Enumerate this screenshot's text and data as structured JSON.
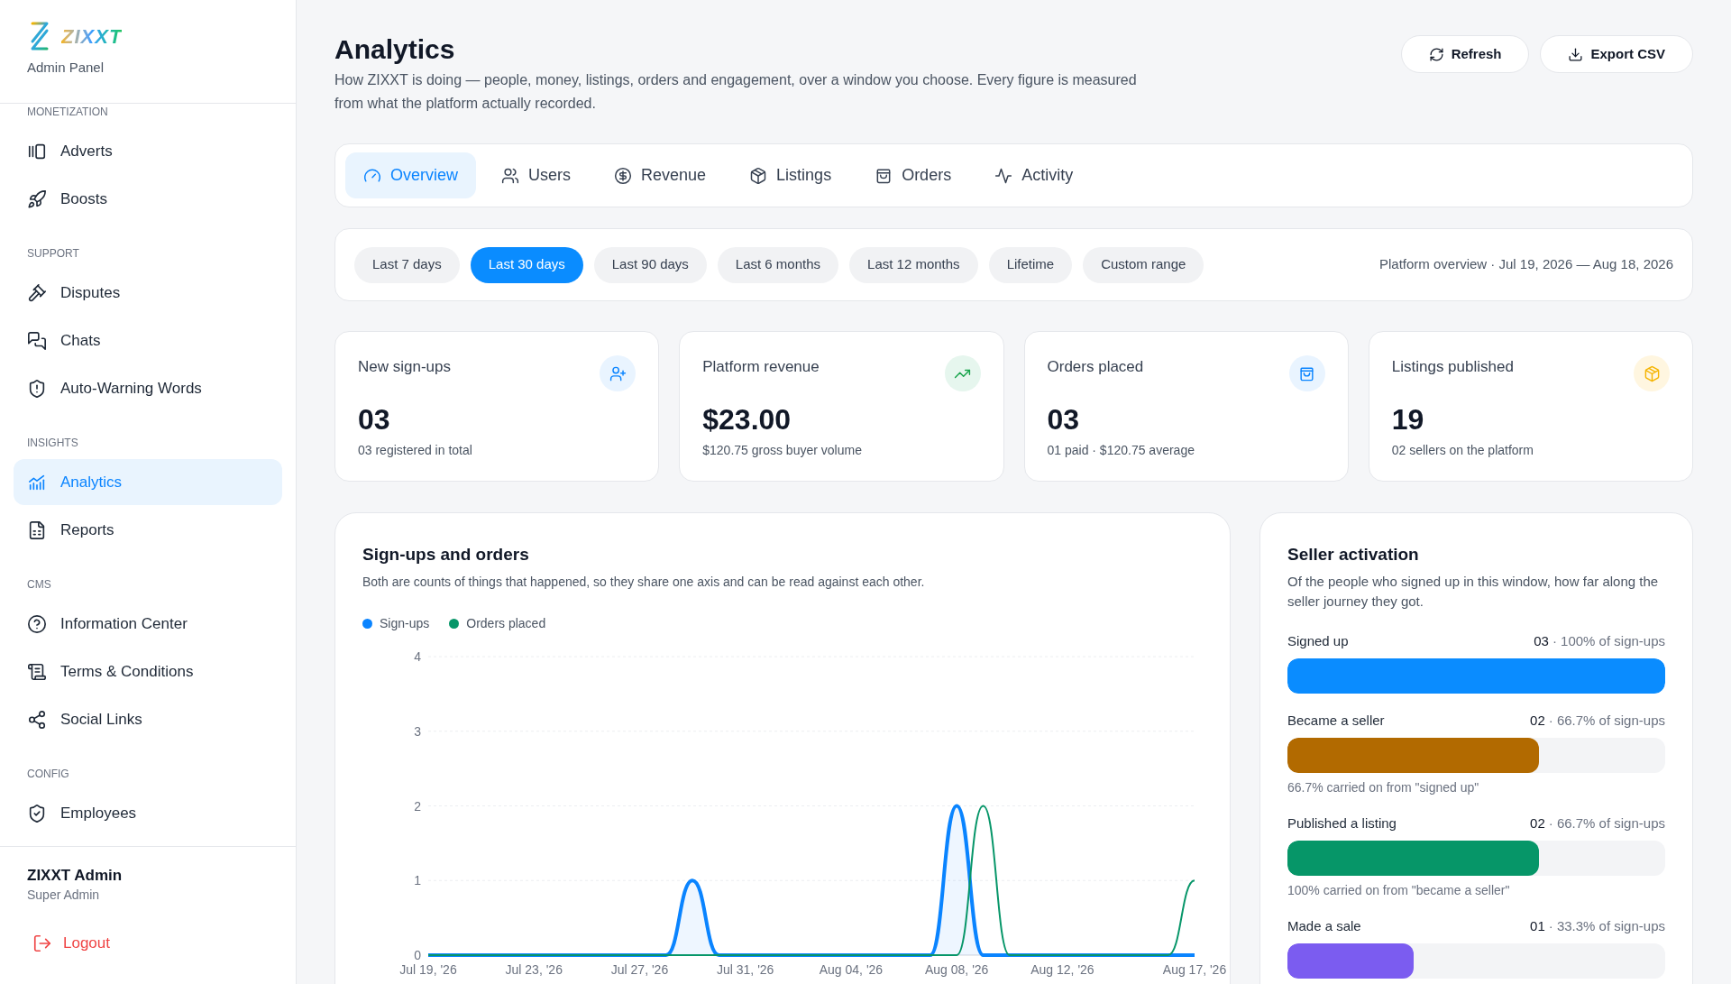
{
  "sidebar": {
    "logo": {
      "wordmark": "ZIXXT",
      "subtitle": "Admin Panel"
    },
    "sections": [
      {
        "heading": "MONETIZATION",
        "items": [
          {
            "label": "Adverts",
            "selected": false
          },
          {
            "label": "Boosts",
            "selected": false
          }
        ]
      },
      {
        "heading": "SUPPORT",
        "items": [
          {
            "label": "Disputes",
            "selected": false
          },
          {
            "label": "Chats",
            "selected": false
          },
          {
            "label": "Auto-Warning Words",
            "selected": false
          }
        ]
      },
      {
        "heading": "INSIGHTS",
        "items": [
          {
            "label": "Analytics",
            "selected": true
          },
          {
            "label": "Reports",
            "selected": false
          }
        ]
      },
      {
        "heading": "CMS",
        "items": [
          {
            "label": "Information Center",
            "selected": false
          },
          {
            "label": "Terms & Conditions",
            "selected": false
          },
          {
            "label": "Social Links",
            "selected": false
          }
        ]
      },
      {
        "heading": "CONFIG",
        "items": [
          {
            "label": "Employees",
            "selected": false
          }
        ]
      }
    ],
    "user": {
      "name": "ZIXXT Admin",
      "role": "Super Admin"
    },
    "logout": "Logout"
  },
  "header": {
    "title": "Analytics",
    "description": "How ZIXXT is doing — people, money, listings, orders and engagement, over a window you choose. Every figure is measured from what the platform actually recorded.",
    "actions": [
      "Refresh",
      "Export CSV"
    ]
  },
  "tabs": [
    {
      "label": "Overview",
      "selected": true
    },
    {
      "label": "Users",
      "selected": false
    },
    {
      "label": "Revenue",
      "selected": false
    },
    {
      "label": "Listings",
      "selected": false
    },
    {
      "label": "Orders",
      "selected": false
    },
    {
      "label": "Activity",
      "selected": false
    }
  ],
  "ranges": [
    {
      "label": "Last 7 days",
      "selected": false
    },
    {
      "label": "Last 30 days",
      "selected": true
    },
    {
      "label": "Last 90 days",
      "selected": false
    },
    {
      "label": "Last 6 months",
      "selected": false
    },
    {
      "label": "Last 12 months",
      "selected": false
    },
    {
      "label": "Lifetime",
      "selected": false
    },
    {
      "label": "Custom range",
      "selected": false
    }
  ],
  "range_summary": "Platform overview · Jul 19, 2026 — Aug 18, 2026",
  "kpis": [
    {
      "label": "New sign-ups",
      "value": "03",
      "detail": "03 registered in total"
    },
    {
      "label": "Platform revenue",
      "value": "$23.00",
      "detail": "$120.75 gross buyer volume"
    },
    {
      "label": "Orders placed",
      "value": "03",
      "detail": "01 paid · $120.75 average"
    },
    {
      "label": "Listings published",
      "value": "19",
      "detail": "02 sellers on the platform"
    }
  ],
  "trend": {
    "title": "Sign-ups and orders",
    "description": "Both are counts of things that happened, so they share one axis and can be read against each other.",
    "chart_data": {
      "type": "line",
      "categories": [
        "Jul 19, '26",
        null,
        null,
        null,
        "Jul 23, '26",
        null,
        null,
        null,
        "Jul 27, '26",
        null,
        null,
        null,
        "Jul 31, '26",
        null,
        null,
        null,
        "Aug 04, '26",
        null,
        null,
        null,
        "Aug 08, '26",
        null,
        null,
        null,
        "Aug 12, '26",
        null,
        null,
        null,
        null,
        "Aug 17, '26"
      ],
      "series": [
        {
          "name": "Sign-ups",
          "color": "#0a84ff",
          "values": [
            0,
            0,
            0,
            0,
            0,
            0,
            0,
            0,
            0,
            0,
            1,
            0,
            0,
            0,
            0,
            0,
            0,
            0,
            0,
            0,
            2,
            0,
            0,
            0,
            0,
            0,
            0,
            0,
            0,
            0
          ]
        },
        {
          "name": "Orders placed",
          "color": "#079669",
          "values": [
            0,
            0,
            0,
            0,
            0,
            0,
            0,
            0,
            0,
            0,
            0,
            0,
            0,
            0,
            0,
            0,
            0,
            0,
            0,
            0,
            0,
            2,
            0,
            0,
            0,
            0,
            0,
            0,
            0,
            1
          ]
        }
      ],
      "ylim": [
        0,
        4
      ],
      "grid": true,
      "yticks": [
        0,
        1,
        2,
        3,
        4
      ]
    }
  },
  "funnel": {
    "title": "Seller activation",
    "description": "Of the people who signed up in this window, how far along the seller journey they got.",
    "steps": [
      {
        "label": "Signed up",
        "count": "03",
        "share": "· 100% of sign-ups",
        "level": 1,
        "color": "#0a8cff"
      },
      {
        "label": "Became a seller",
        "count": "02",
        "share": "· 66.7% of sign-ups",
        "level": 0.667,
        "color": "#b26a00",
        "note": "66.7% carried on from \"signed up\""
      },
      {
        "label": "Published a listing",
        "count": "02",
        "share": "· 66.7% of sign-ups",
        "level": 0.667,
        "color": "#069668",
        "note": "100% carried on from \"became a seller\""
      },
      {
        "label": "Made a sale",
        "count": "01",
        "share": "· 33.3% of sign-ups",
        "level": 0.333,
        "color": "#7b5cf0"
      }
    ]
  }
}
